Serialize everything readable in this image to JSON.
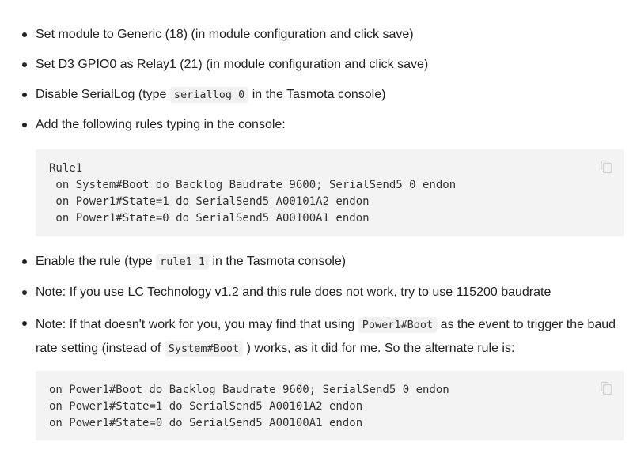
{
  "steps": [
    {
      "text": "Set module to Generic (18) (in module configuration and click save)"
    },
    {
      "text": "Set D3 GPIO0 as Relay1 (21) (in module configuration and click save)"
    },
    {
      "before": "Disable SerialLog (type ",
      "code": "seriallog 0",
      "after": " in the Tasmota console)"
    },
    {
      "text": "Add the following rules typing in the console:"
    }
  ],
  "code_block_1": {
    "lines": [
      "Rule1",
      " on System#Boot do Backlog Baudrate 9600; SerialSend5 0 endon",
      " on Power1#State=1 do SerialSend5 A00101A2 endon",
      " on Power1#State=0 do SerialSend5 A00100A1 endon"
    ],
    "copy_icon": "copy-icon"
  },
  "steps_after": [
    {
      "before": "Enable the rule (type ",
      "code": "rule1 1",
      "after": " in the Tasmota console)"
    },
    {
      "text": "Note: If you use LC Technology v1.2 and this rule does not work, try to use 115200 baudrate"
    },
    {
      "part1": "Note: If that doesn't work for you, you may find that using ",
      "code1": "Power1#Boot",
      "part2": " as the event to trigger the baud rate setting (instead of ",
      "code2": "System#Boot",
      "part3": " ) works, as it did for me. So the alternate rule is:"
    }
  ],
  "code_block_2": {
    "lines": [
      "on Power1#Boot do Backlog Baudrate 9600; SerialSend5 0 endon",
      "on Power1#State=1 do SerialSend5 A00101A2 endon",
      "on Power1#State=0 do SerialSend5 A00100A1 endon"
    ],
    "copy_icon": "copy-icon"
  }
}
